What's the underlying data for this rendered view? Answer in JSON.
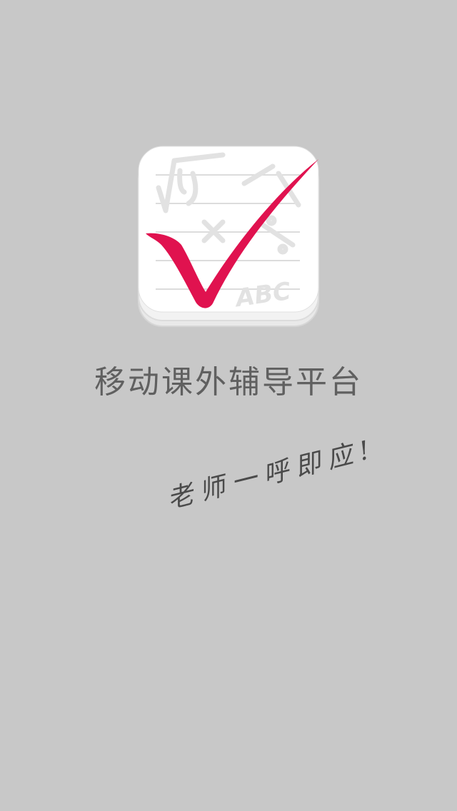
{
  "app": {
    "name": "移动课外辅导平台",
    "slogan": "老师一呼即应!",
    "icon": "checkmark-notebook-icon"
  },
  "colors": {
    "background": "#c8c8c8",
    "checkmark": "#e0124f",
    "title_text": "#606060",
    "slogan_text": "#4a4a4a"
  }
}
